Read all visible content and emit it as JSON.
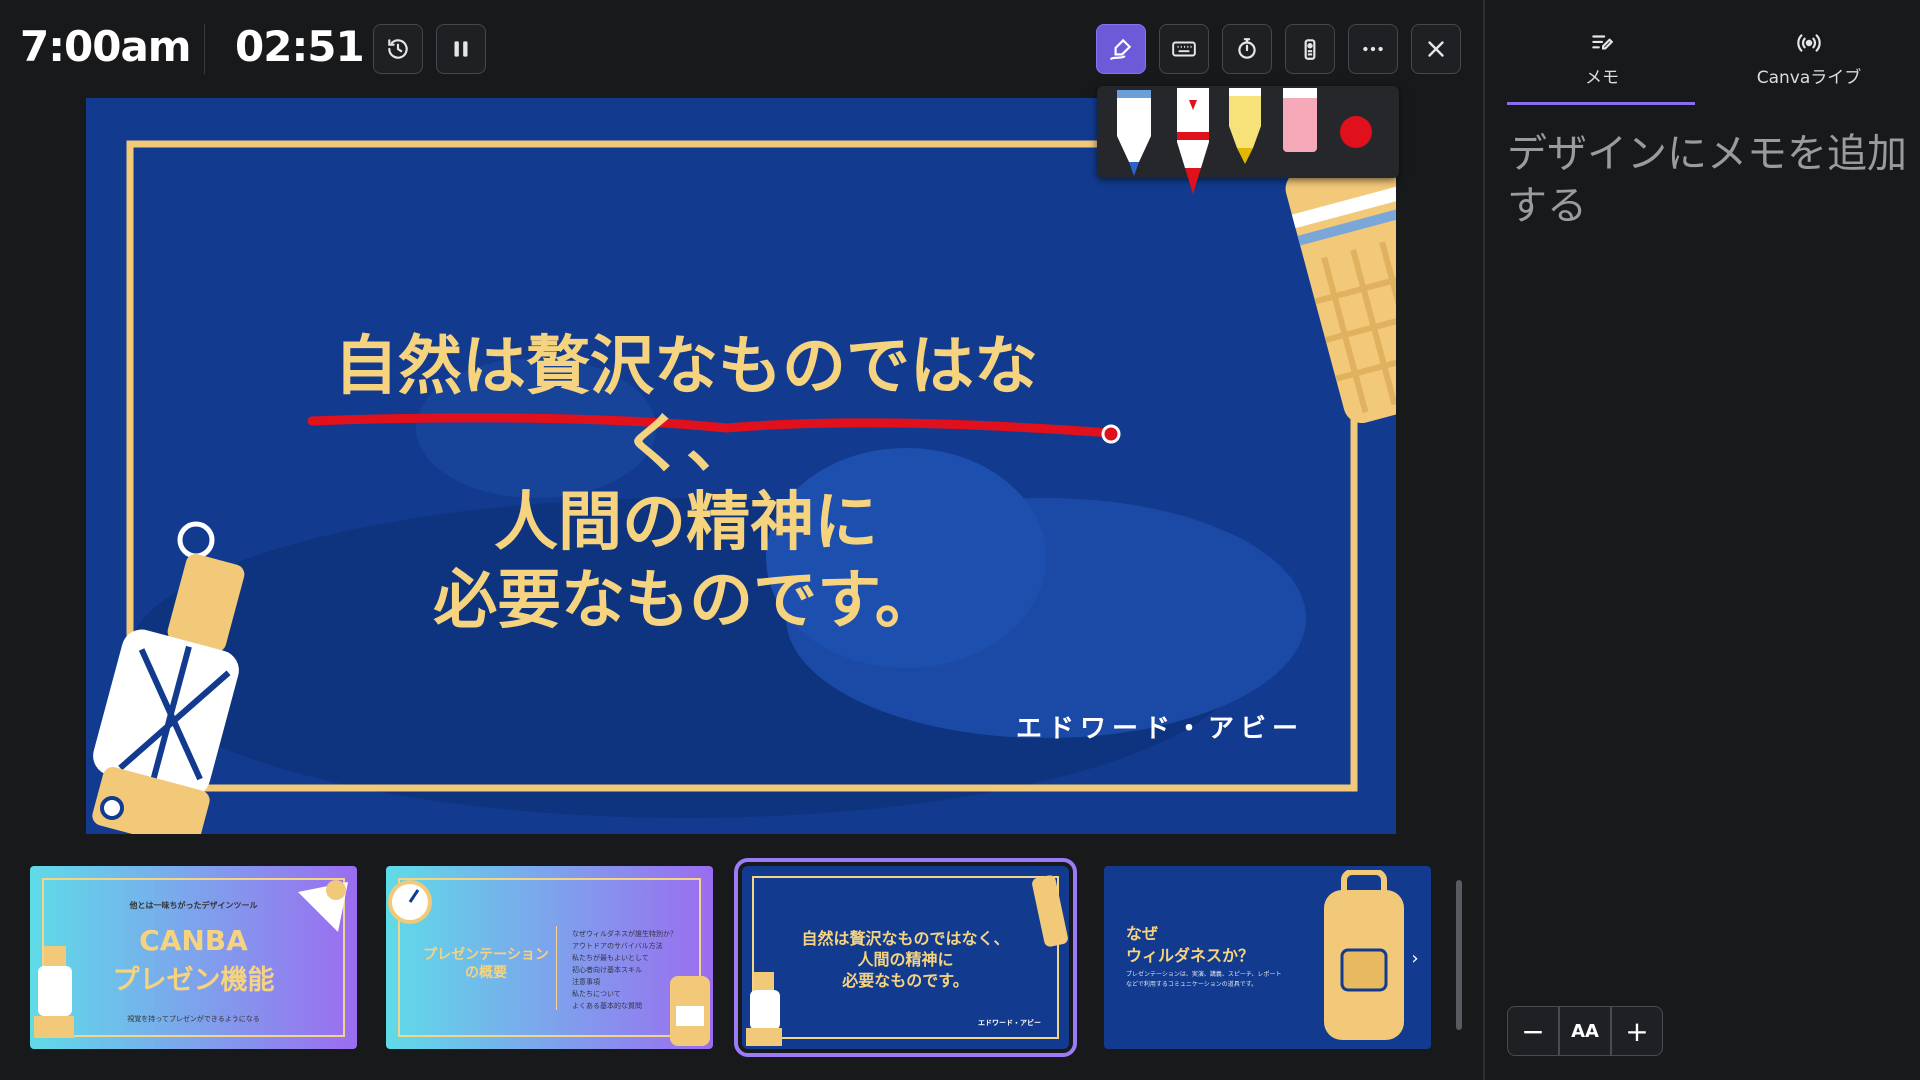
{
  "topbar": {
    "clock": "7:00am",
    "timer": "02:51",
    "buttons": [
      "history-icon",
      "pause-icon",
      "draw-icon",
      "keyboard-icon",
      "stopwatch-icon",
      "remote-icon",
      "more-icon",
      "close-icon"
    ]
  },
  "slide": {
    "quote_line1": "自然は贅沢なものではなく、",
    "quote_line2": "人間の精神に",
    "quote_line3": "必要なものです。",
    "author": "エドワード・アビー",
    "colors": {
      "bg": "#123b8f",
      "frame": "#f2c879",
      "text": "#f6d37f",
      "annotation": "#e0101d"
    }
  },
  "pens": [
    "blue-pen",
    "red-marker",
    "yellow-highlighter",
    "eraser",
    "red-dot"
  ],
  "thumbnails": [
    {
      "small": "他とは一味ちがったデザインツール",
      "title1": "CANBA",
      "title2": "プレゼン機能",
      "footer": "視覚を持ってプレゼンができるようになる"
    },
    {
      "title1": "プレゼンテーション",
      "title2": "の概要",
      "list": [
        "なぜウィルダネスが誰生特別か？",
        "アウトドアのサバイバル方法",
        "私たちが最もよいとして",
        "初心者向け基本スキル",
        "注意事項",
        "私たちについて",
        "よくある基本的な質問"
      ]
    },
    {
      "line1": "自然は贅沢なものではなく、",
      "line2": "人間の精神に",
      "line3": "必要なものです。",
      "author": "エドワード・アビー"
    },
    {
      "title1": "なぜ",
      "title2": "ウィルダネスか？",
      "body": "プレゼンテーションは、実演、講義、スピーチ、レポートなどで利用するコミュニケーションの道具です。"
    }
  ],
  "side": {
    "tab_notes": "メモ",
    "tab_live": "Canvaライブ",
    "notes_placeholder_1": "デザインにメモを追加",
    "notes_placeholder_2": "する",
    "zoom_minus": "−",
    "zoom_font": "AA",
    "zoom_plus": "+"
  }
}
